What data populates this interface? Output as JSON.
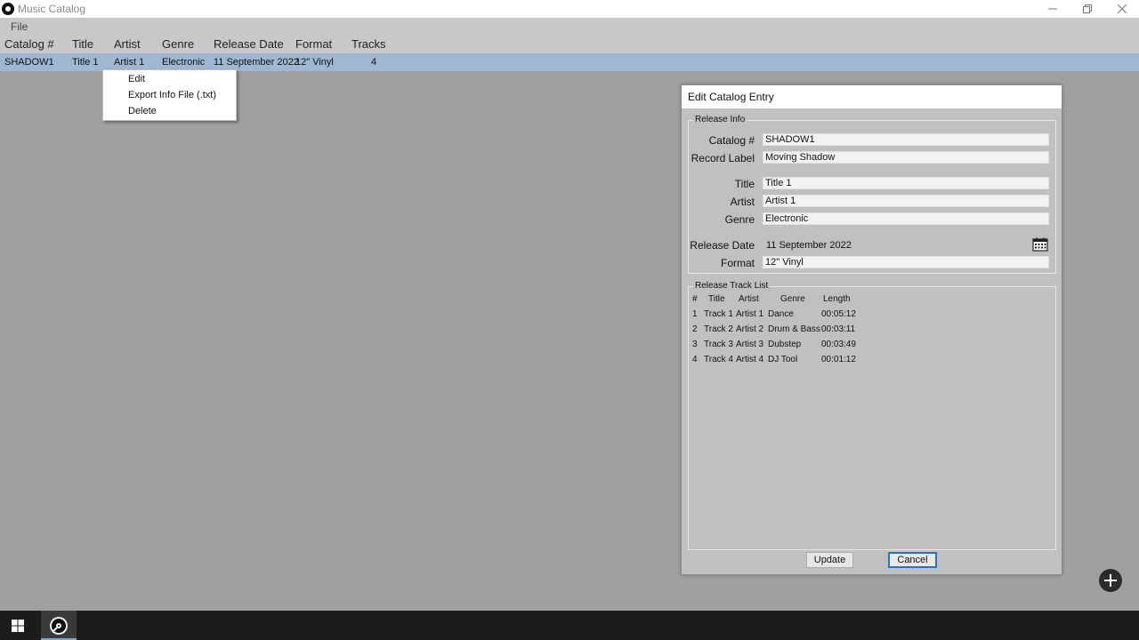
{
  "window": {
    "title": "Music Catalog"
  },
  "menu": {
    "file": "File"
  },
  "table": {
    "headers": [
      "Catalog #",
      "Title",
      "Artist",
      "Genre",
      "Release Date",
      "Format",
      "Tracks"
    ],
    "rows": [
      [
        "SHADOW1",
        "Title 1",
        "Artist 1",
        "Electronic",
        "11 September 2022",
        "12\" Vinyl",
        "4"
      ]
    ]
  },
  "context_menu": {
    "items": [
      "Edit",
      "Export Info File (.txt)",
      "Delete"
    ]
  },
  "dialog": {
    "title": "Edit Catalog Entry",
    "release_info": {
      "group_label": "Release Info",
      "catalog_label": "Catalog #",
      "catalog_value": "SHADOW1",
      "record_label_label": "Record Label",
      "record_label_value": "Moving Shadow",
      "title_label": "Title",
      "title_value": "Title 1",
      "artist_label": "Artist",
      "artist_value": "Artist 1",
      "genre_label": "Genre",
      "genre_value": "Electronic",
      "release_date_label": "Release Date",
      "release_date_value": "11 September 2022",
      "format_label": "Format",
      "format_value": "12\" Vinyl"
    },
    "track_list": {
      "group_label": "Release Track List",
      "headers": [
        "#",
        "Title",
        "Artist",
        "Genre",
        "Length"
      ],
      "rows": [
        [
          "1",
          "Track 1",
          "Artist 1",
          "Dance",
          "00:05:12"
        ],
        [
          "2",
          "Track 2",
          "Artist 2",
          "Drum & Bass",
          "00:03:11"
        ],
        [
          "3",
          "Track 3",
          "Artist 3",
          "Dubstep",
          "00:03:49"
        ],
        [
          "4",
          "Track 4",
          "Artist 4",
          "DJ Tool",
          "00:01:12"
        ]
      ]
    },
    "buttons": {
      "update": "Update",
      "cancel": "Cancel"
    }
  },
  "icons": {
    "app": "vinyl-record-icon",
    "minimize": "minimize-icon",
    "restore": "restore-icon",
    "close": "close-icon",
    "calendar": "calendar-icon",
    "add": "plus-circle-icon",
    "start": "windows-start-icon"
  },
  "colors": {
    "selection": "#9fb7d1",
    "default_button_border": "#2a6fc9",
    "taskbar": "#1c1c1c"
  }
}
